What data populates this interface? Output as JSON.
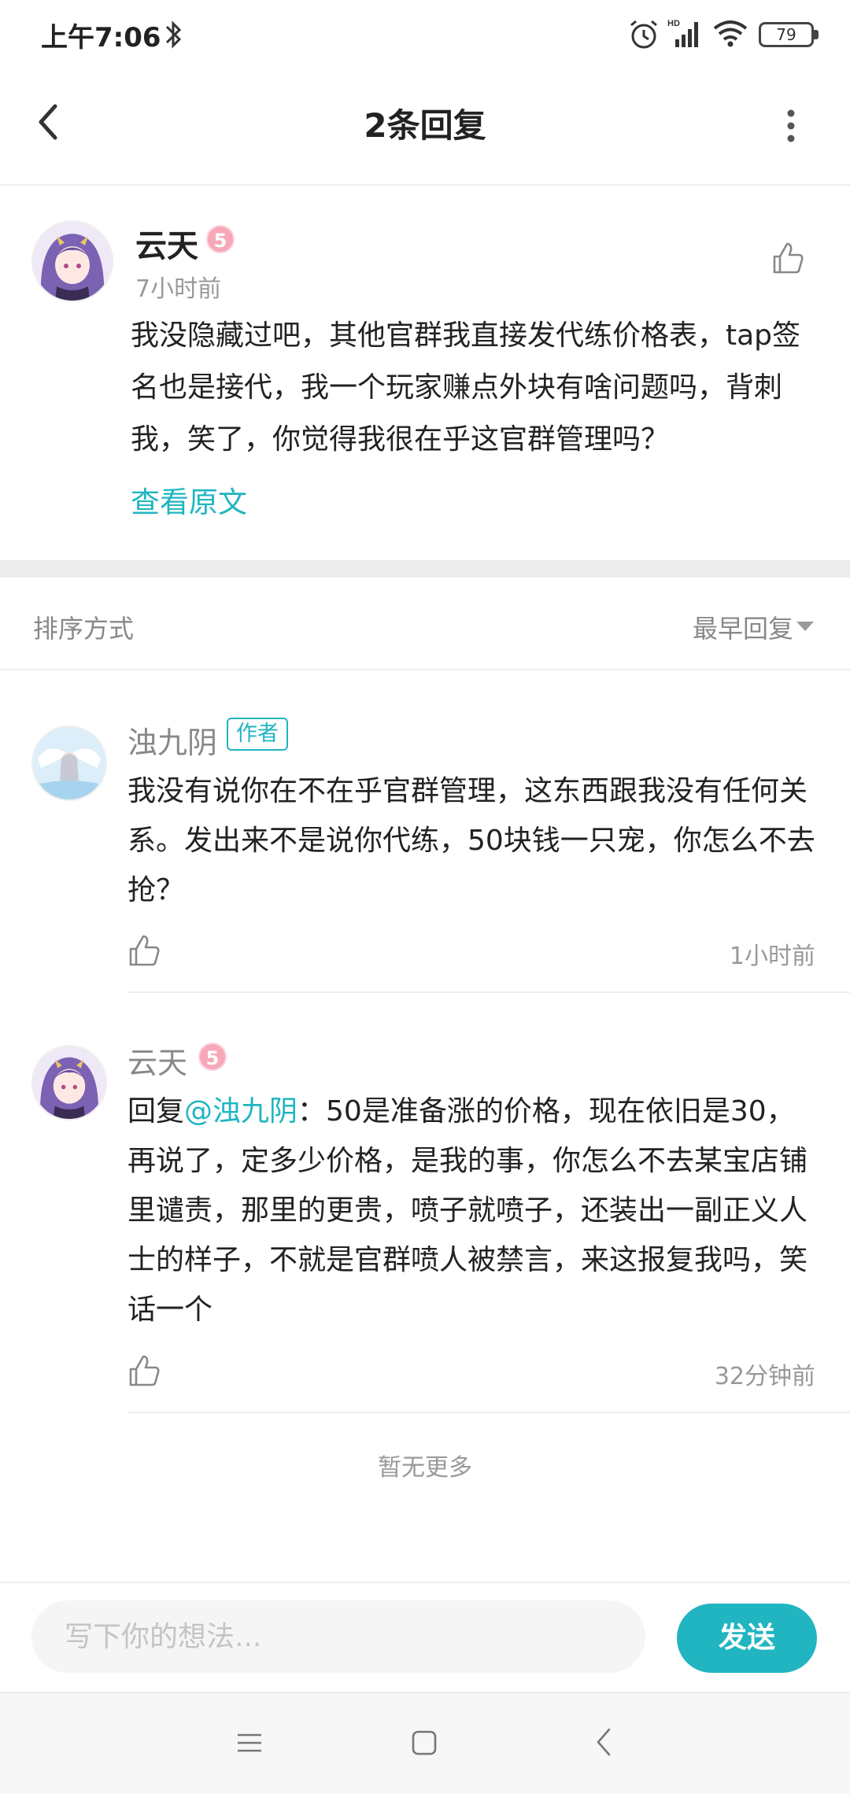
{
  "status_bar": {
    "time": "上午7:06",
    "battery": "79",
    "hd_label": "HD"
  },
  "header": {
    "title": "2条回复"
  },
  "post": {
    "author": "云天",
    "level": "5",
    "time": "7小时前",
    "content": "我没隐藏过吧，其他官群我直接发代练价格表，tap签名也是接代，我一个玩家赚点外块有啥问题吗，背刺我，笑了，你觉得我很在乎这官群管理吗？",
    "view_original": "查看原文"
  },
  "sort": {
    "label": "排序方式",
    "value": "最早回复"
  },
  "replies": [
    {
      "author": "浊九阴",
      "badge": "作者",
      "content": "我没有说你在不在乎官群管理，这东西跟我没有任何关系。发出来不是说你代练，50块钱一只宠，你怎么不去抢？",
      "time": "1小时前"
    },
    {
      "author": "云天",
      "level": "5",
      "reply_prefix": "回复",
      "mention": "@浊九阴",
      "content": "：50是准备涨的价格，现在依旧是30，再说了，定多少价格，是我的事，你怎么不去某宝店铺里谴责，那里的更贵，喷子就喷子，还装出一副正义人士的样子，不就是官群喷人被禁言，来这报复我吗，笑话一个",
      "time": "32分钟前"
    }
  ],
  "footer": {
    "no_more": "暂无更多"
  },
  "input_bar": {
    "placeholder": "写下你的想法...",
    "send_label": "发送"
  },
  "colors": {
    "accent": "#20b5c1",
    "level_badge": "#f7a8b8"
  }
}
